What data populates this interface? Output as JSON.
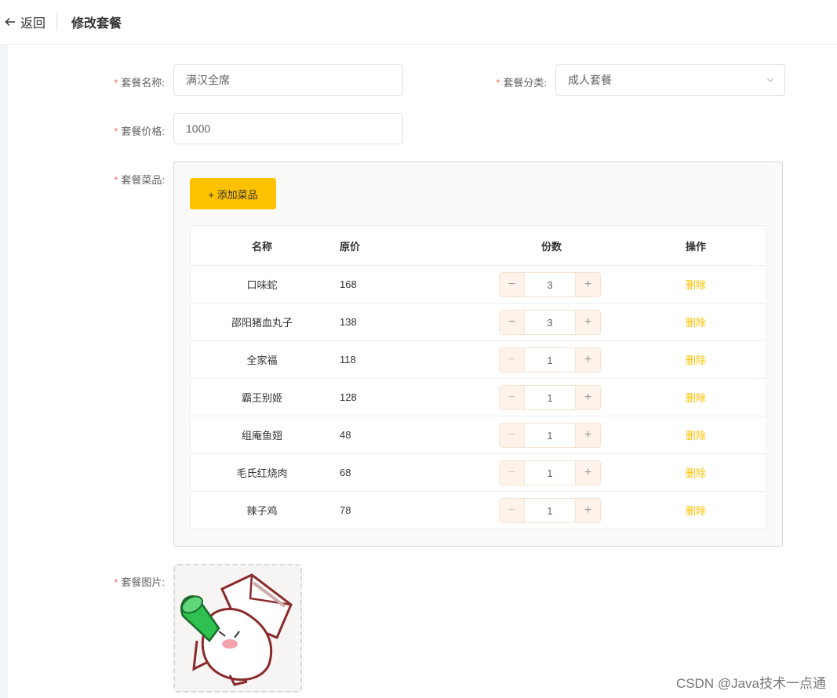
{
  "header": {
    "back_label": "返回",
    "title": "修改套餐"
  },
  "form": {
    "name": {
      "label": "套餐名称:",
      "value": "满汉全席"
    },
    "category": {
      "label": "套餐分类:",
      "value": "成人套餐"
    },
    "price": {
      "label": "套餐价格:",
      "value": "1000"
    },
    "dishes": {
      "label": "套餐菜品:",
      "add_button": "+ 添加菜品"
    },
    "image": {
      "label": "套餐图片:"
    }
  },
  "table": {
    "columns": {
      "name": "名称",
      "price": "原价",
      "copies": "份数",
      "op": "操作"
    },
    "rows": [
      {
        "name": "口味蛇",
        "price": "168",
        "copies": "3",
        "op": "删除"
      },
      {
        "name": "邵阳猪血丸子",
        "price": "138",
        "copies": "3",
        "op": "删除"
      },
      {
        "name": "全家福",
        "price": "118",
        "copies": "1",
        "op": "删除"
      },
      {
        "name": "霸王别姬",
        "price": "128",
        "copies": "1",
        "op": "删除"
      },
      {
        "name": "组庵鱼翅",
        "price": "48",
        "copies": "1",
        "op": "删除"
      },
      {
        "name": "毛氏红烧肉",
        "price": "68",
        "copies": "1",
        "op": "删除"
      },
      {
        "name": "辣子鸡",
        "price": "78",
        "copies": "1",
        "op": "删除"
      }
    ]
  },
  "stepper": {
    "minus": "−",
    "plus": "+"
  },
  "watermark": "CSDN @Java技术一点通",
  "colors": {
    "accent": "#ffc200",
    "required": "#f56c6c"
  }
}
